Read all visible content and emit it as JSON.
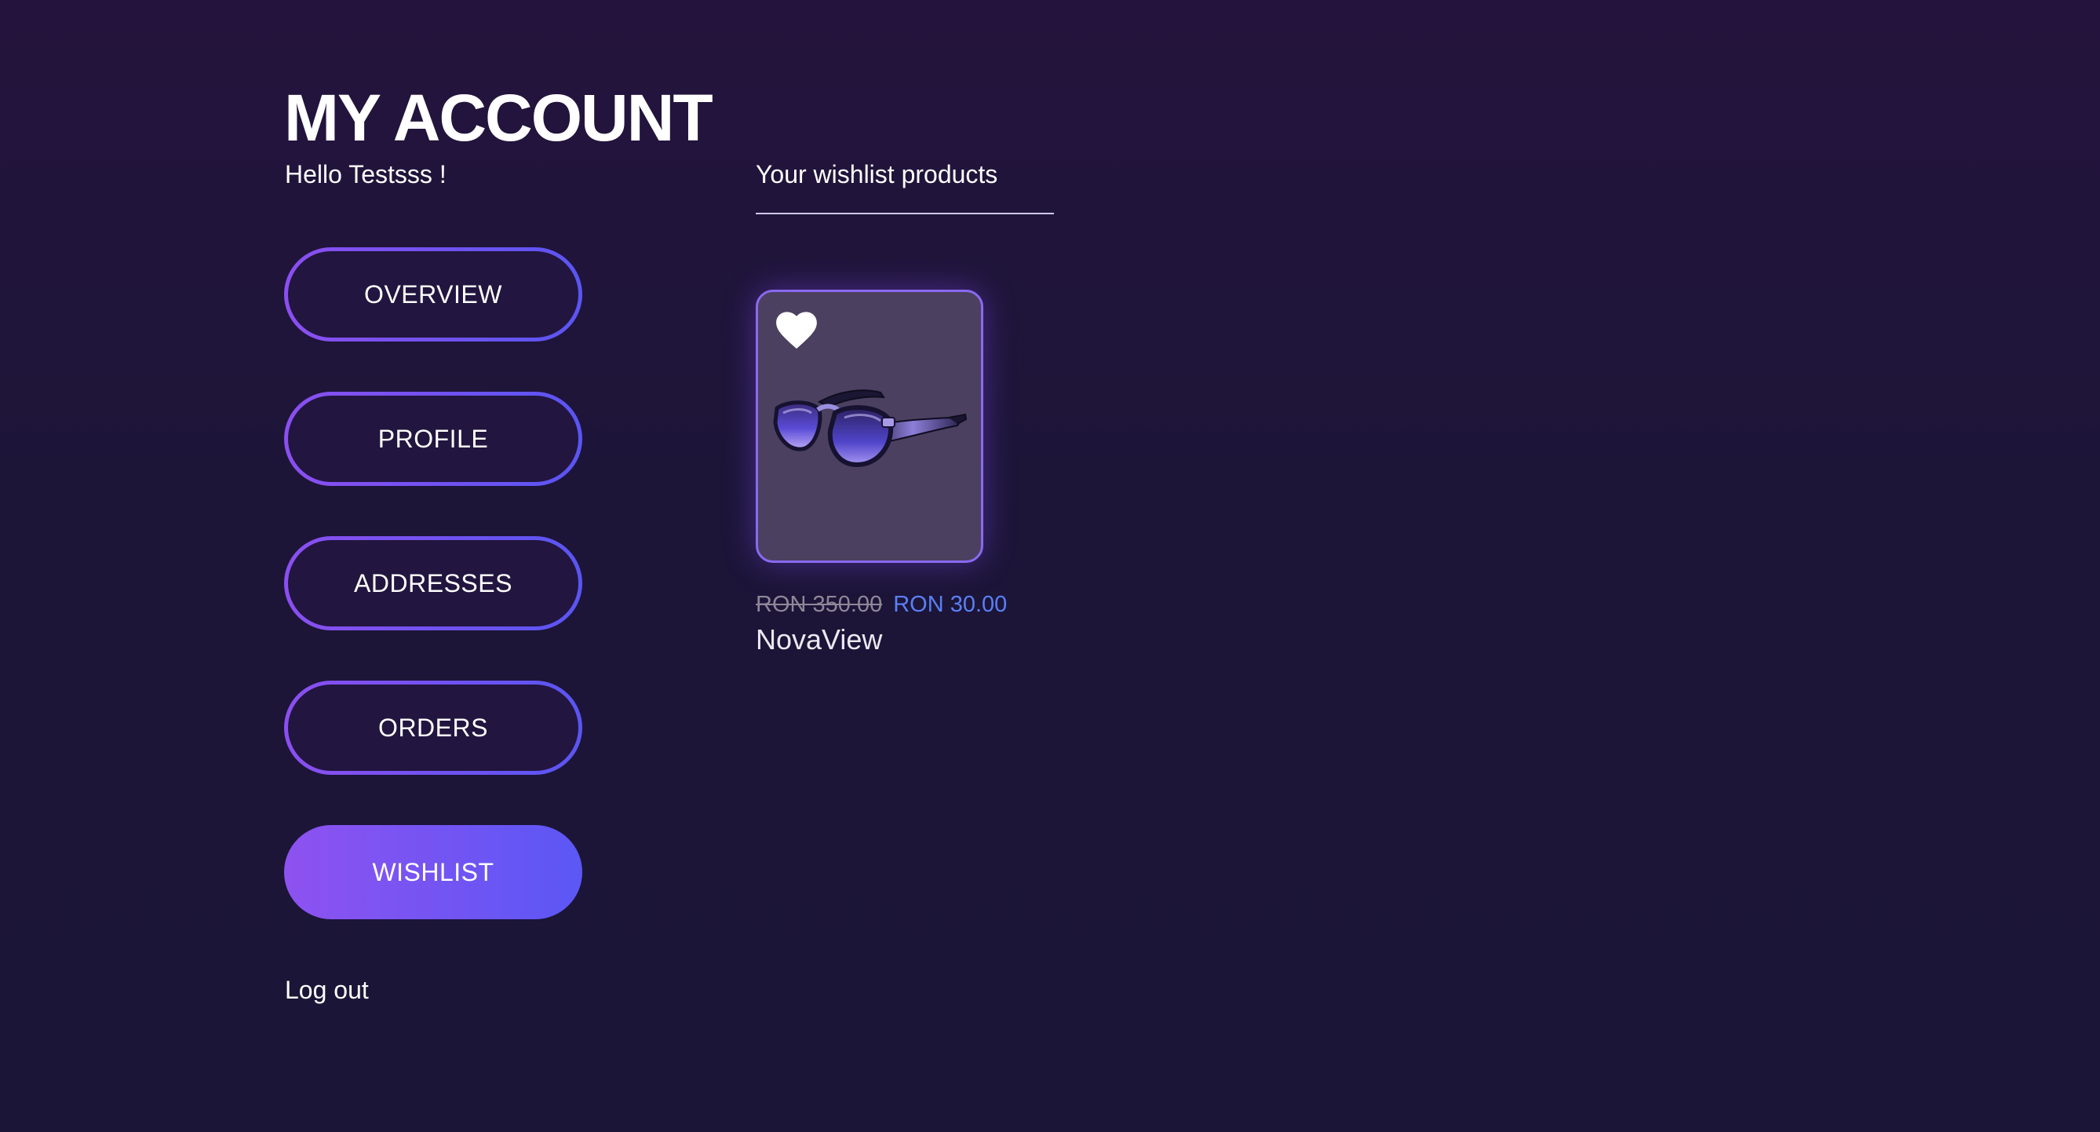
{
  "account": {
    "title": "MY ACCOUNT",
    "greeting": "Hello Testsss !"
  },
  "nav": {
    "items": [
      {
        "label": "OVERVIEW",
        "active": false
      },
      {
        "label": "PROFILE",
        "active": false
      },
      {
        "label": "ADDRESSES",
        "active": false
      },
      {
        "label": "ORDERS",
        "active": false
      },
      {
        "label": "WISHLIST",
        "active": true
      }
    ],
    "logout_label": "Log out"
  },
  "wishlist": {
    "section_title": "Your wishlist products",
    "products": [
      {
        "name": "NovaView",
        "old_price": "RON 350.00",
        "price": "RON 30.00",
        "icon": "heart-icon",
        "image": "sunglasses-image"
      }
    ]
  },
  "colors": {
    "background": "#1c1538",
    "accent_start": "#8e52f0",
    "accent_end": "#5b57f5",
    "price": "#5b7ff5",
    "old_price": "#8e8798",
    "card": "#4b405f"
  }
}
